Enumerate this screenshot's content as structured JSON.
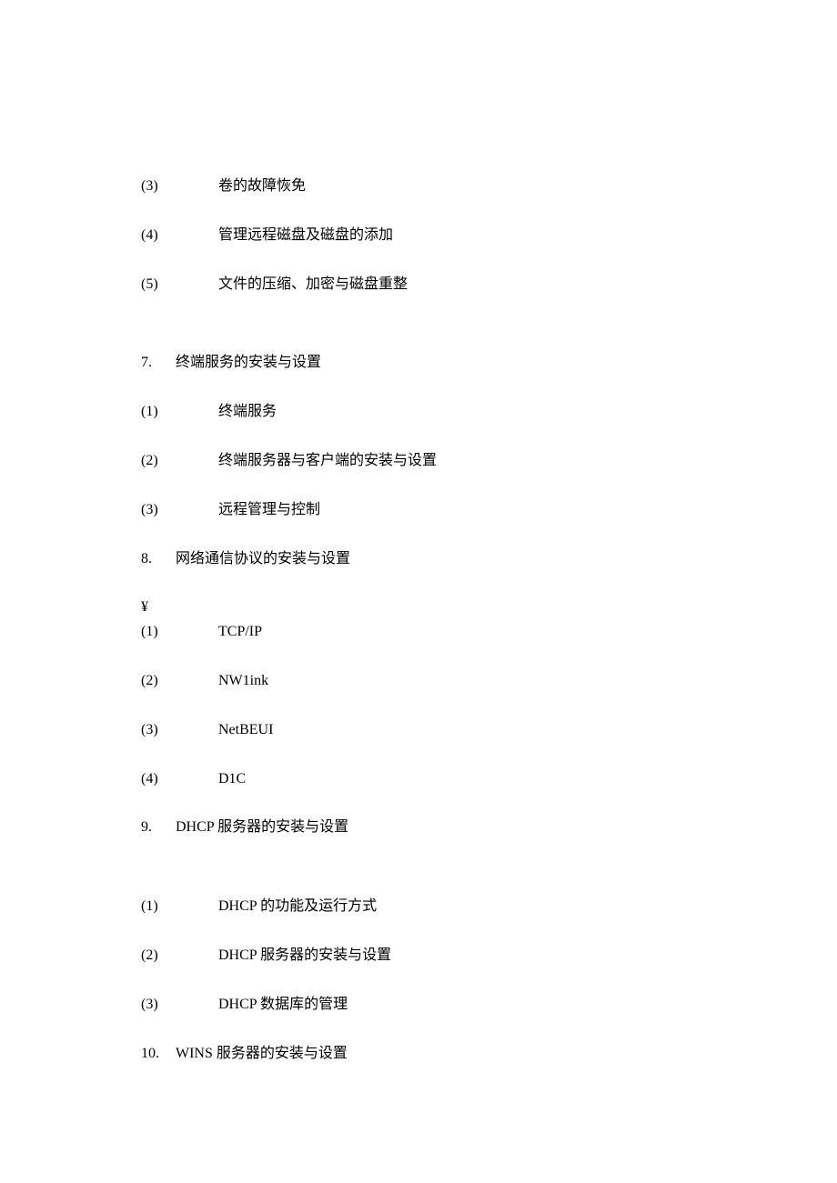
{
  "lines": [
    {
      "type": "sub",
      "num": "(3)",
      "text": "卷的故障恢免"
    },
    {
      "type": "sub",
      "num": "(4)",
      "text": "管理远程磁盘及磁盘的添加"
    },
    {
      "type": "sub",
      "num": "(5)",
      "text": "文件的压缩、加密与磁盘重整"
    },
    {
      "type": "heading",
      "num": "7.",
      "text": "终端服务的安装与设置",
      "gap": true
    },
    {
      "type": "sub",
      "num": "(1)",
      "text": "终端服务"
    },
    {
      "type": "sub",
      "num": "(2)",
      "text": "终端服务器与客户端的安装与设置"
    },
    {
      "type": "sub",
      "num": "(3)",
      "text": "远程管理与控制"
    },
    {
      "type": "heading",
      "num": "8.",
      "text": "网络通信协议的安装与设置"
    },
    {
      "type": "special",
      "text": "¥"
    },
    {
      "type": "sub",
      "num": "(1)",
      "text": "TCP/IP"
    },
    {
      "type": "sub",
      "num": "(2)",
      "text": "NW1ink"
    },
    {
      "type": "sub",
      "num": "(3)",
      "text": "NetBEUI"
    },
    {
      "type": "sub",
      "num": "(4)",
      "text": "D1C"
    },
    {
      "type": "heading",
      "num": "9.",
      "text": "DHCP 服务器的安装与设置"
    },
    {
      "type": "sub",
      "num": "(1)",
      "text": "DHCP 的功能及运行方式",
      "gap": true
    },
    {
      "type": "sub",
      "num": "(2)",
      "text": "DHCP 服务器的安装与设置"
    },
    {
      "type": "sub",
      "num": "(3)",
      "text": "DHCP 数据库的管理"
    },
    {
      "type": "heading",
      "num": "10.",
      "text": "WINS 服务器的安装与设置"
    }
  ]
}
